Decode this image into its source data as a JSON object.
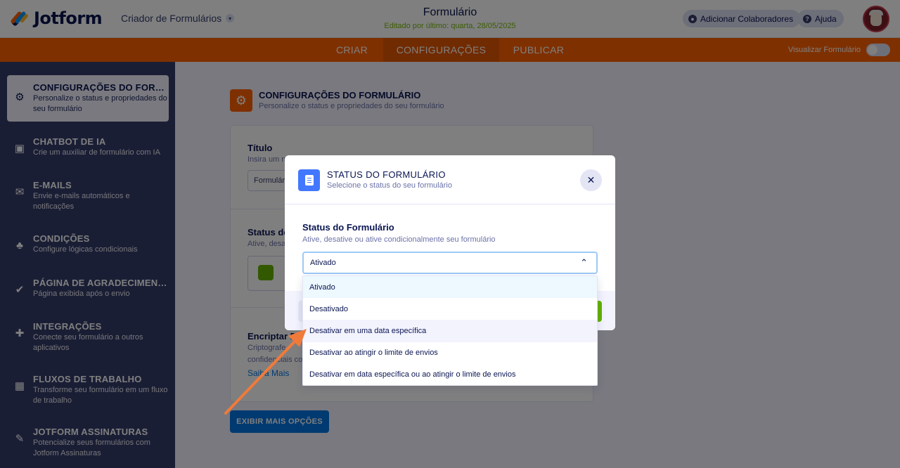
{
  "header": {
    "brand": "Jotform",
    "creator_label": "Criador de Formulários",
    "form_title": "Formulário",
    "last_edited": "Editado por último: quarta, 28/05/2025",
    "collaborators_button": "Adicionar Colaboradores",
    "help_button": "Ajuda"
  },
  "nav": {
    "tabs": [
      {
        "label": "CRIAR",
        "active": false
      },
      {
        "label": "CONFIGURAÇÕES",
        "active": true
      },
      {
        "label": "PUBLICAR",
        "active": false
      }
    ],
    "preview_label": "Visualizar Formulário",
    "preview_on": false
  },
  "sidebar": {
    "items": [
      {
        "title": "CONFIGURAÇÕES DO FORMULÁRIO",
        "desc": "Personalize o status e propriedades do seu formulário",
        "icon": "gear-icon",
        "active": true
      },
      {
        "title": "CHATBOT DE IA",
        "desc": "Crie um auxiliar de formulário com IA",
        "icon": "robot-icon"
      },
      {
        "title": "E-MAILS",
        "desc": "Envie e-mails automáticos e notificações",
        "icon": "envelope-icon"
      },
      {
        "title": "CONDIÇÕES",
        "desc": "Configure lógicas condicionais",
        "icon": "hierarchy-icon"
      },
      {
        "title": "PÁGINA DE AGRADECIMENTO",
        "desc": "Página exibida após o envio",
        "icon": "check-circle-icon"
      },
      {
        "title": "INTEGRAÇÕES",
        "desc": "Conecte seu formulário a outros aplicativos",
        "icon": "puzzle-icon"
      },
      {
        "title": "FLUXOS DE TRABALHO",
        "desc": "Transforme seu formulário em um fluxo de trabalho",
        "icon": "workflow-icon"
      },
      {
        "title": "JOTFORM ASSINATURAS",
        "desc": "Potencialize seus formulários com Jotform Assinaturas",
        "icon": "signature-pen-icon"
      }
    ]
  },
  "main": {
    "section_title": "CONFIGURAÇÕES DO FORMULÁRIO",
    "section_sub": "Personalize o status e propriedades do seu formulário",
    "title_label": "Título",
    "title_hint": "Insira um n",
    "title_value": "Formulár",
    "status_label": "Status do",
    "status_hint": "Ative, desa",
    "encrypt_label": "Encriptar Da",
    "encrypt_hint_1": "Criptografe",
    "encrypt_hint_2": "confidenciais co",
    "learn_more": "Saiba Mais",
    "more_options_button": "EXIBIR MAIS OPÇÕES"
  },
  "modal": {
    "title": "STATUS DO FORMULÁRIO",
    "subtitle": "Selecione o status do seu formulário",
    "close": "✕",
    "field_label": "Status do Formulário",
    "field_hint": "Ative, desative ou ative condicionalmente seu formulário",
    "selected": "Ativado",
    "options": [
      "Ativado",
      "Desativado",
      "Desativar em uma data específica",
      "Desativar ao atingir o limite de envios",
      "Desativar em data específica ou ao atingir o limite de envios"
    ]
  },
  "colors": {
    "orange": "#ff6100",
    "navy": "#0a1551",
    "sidebar": "#343c6a",
    "blue": "#0075e3",
    "green": "#64b200",
    "annotation_arrow": "#f07a3a"
  }
}
